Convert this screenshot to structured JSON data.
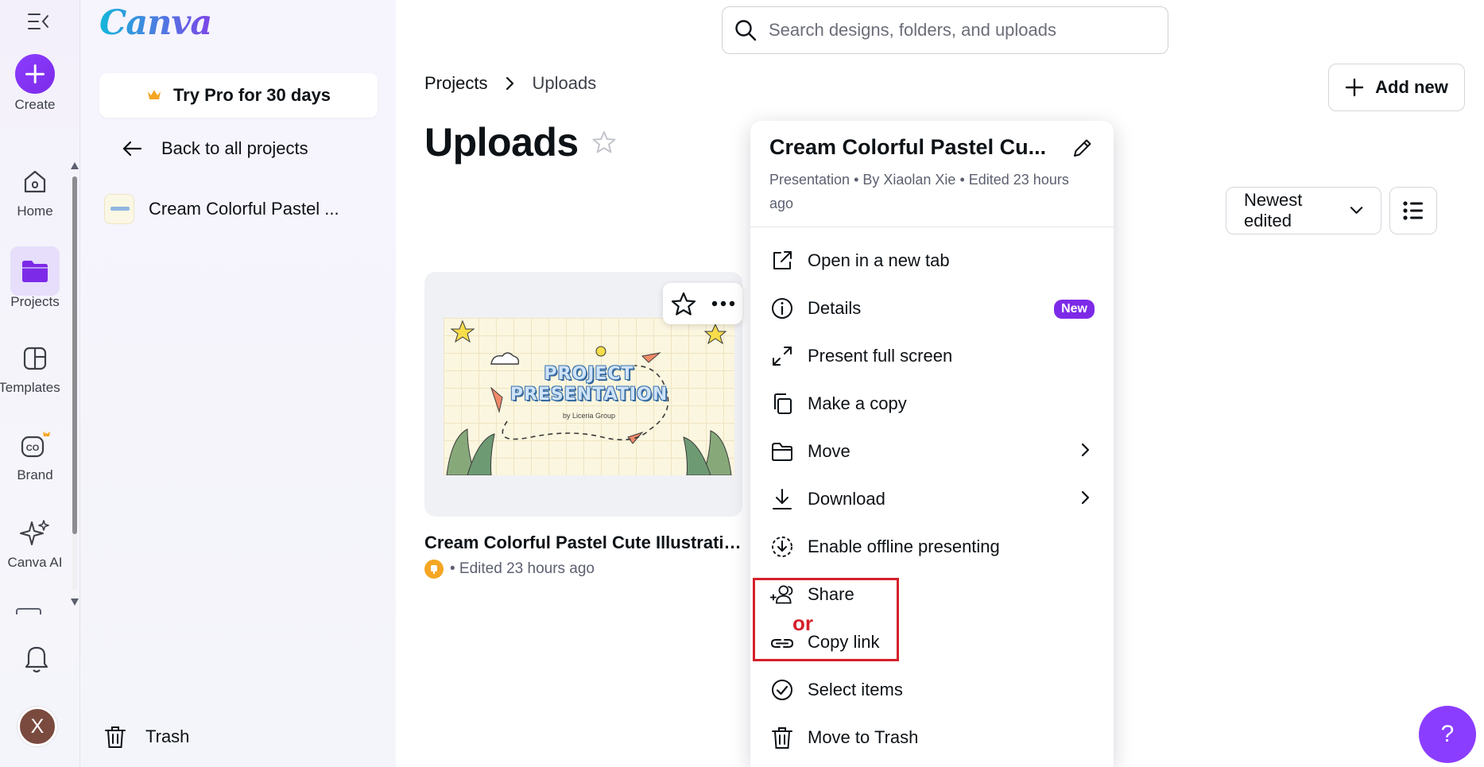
{
  "rail": {
    "create_label": "Create",
    "home_label": "Home",
    "projects_label": "Projects",
    "templates_label": "Templates",
    "brand_label": "Brand",
    "canva_ai_label": "Canva AI",
    "avatar_initial": "X"
  },
  "panel": {
    "logo": "Canva",
    "try_pro_label": "Try Pro for 30 days",
    "back_label": "Back to all projects",
    "project_item_label": "Cream Colorful Pastel ...",
    "trash_label": "Trash"
  },
  "search": {
    "placeholder": "Search designs, folders, and uploads"
  },
  "header": {
    "breadcrumb_root": "Projects",
    "breadcrumb_current": "Uploads",
    "title": "Uploads",
    "add_new_label": "Add new",
    "sort_label": "Newest edited"
  },
  "card": {
    "thumb_line1": "PROJECT",
    "thumb_line2": "PRESENTATION",
    "thumb_sub": "by Liceria Group",
    "name": "Cream Colorful Pastel Cute Illustratio...",
    "meta": "• Edited 23 hours ago"
  },
  "menu": {
    "title": "Cream Colorful Pastel Cu...",
    "subtitle": "Presentation • By Xiaolan Xie • Edited 23 hours ago",
    "items": [
      {
        "label": "Open in a new tab"
      },
      {
        "label": "Details",
        "badge": "New"
      },
      {
        "label": "Present full screen"
      },
      {
        "label": "Make a copy"
      },
      {
        "label": "Move"
      },
      {
        "label": "Download"
      },
      {
        "label": "Enable offline presenting"
      },
      {
        "label": "Share"
      },
      {
        "label": "Copy link"
      },
      {
        "label": "Select items"
      },
      {
        "label": "Move to Trash"
      }
    ],
    "annotation": "or"
  },
  "help_label": "?",
  "colors": {
    "accent": "#7d2ae8",
    "highlight": "#d4202a",
    "active_bg": "#e6defb"
  }
}
